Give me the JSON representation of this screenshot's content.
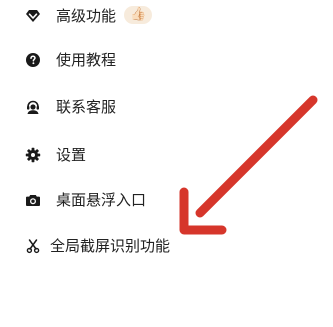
{
  "menu": {
    "items": [
      {
        "label": "高级功能",
        "icon": "diamond-icon",
        "badge": "👍🏻"
      },
      {
        "label": "使用教程",
        "icon": "help-circle-icon"
      },
      {
        "label": "联系客服",
        "icon": "headset-icon"
      },
      {
        "label": "设置",
        "icon": "gear-icon"
      },
      {
        "label": "桌面悬浮入口",
        "icon": "camera-icon"
      },
      {
        "label": "全局截屏识别功能",
        "icon": "scissors-icon"
      }
    ]
  },
  "colors": {
    "text": "#222222",
    "icon": "#1a1a1a",
    "arrow": "#d6362b",
    "background": "#ffffff"
  }
}
